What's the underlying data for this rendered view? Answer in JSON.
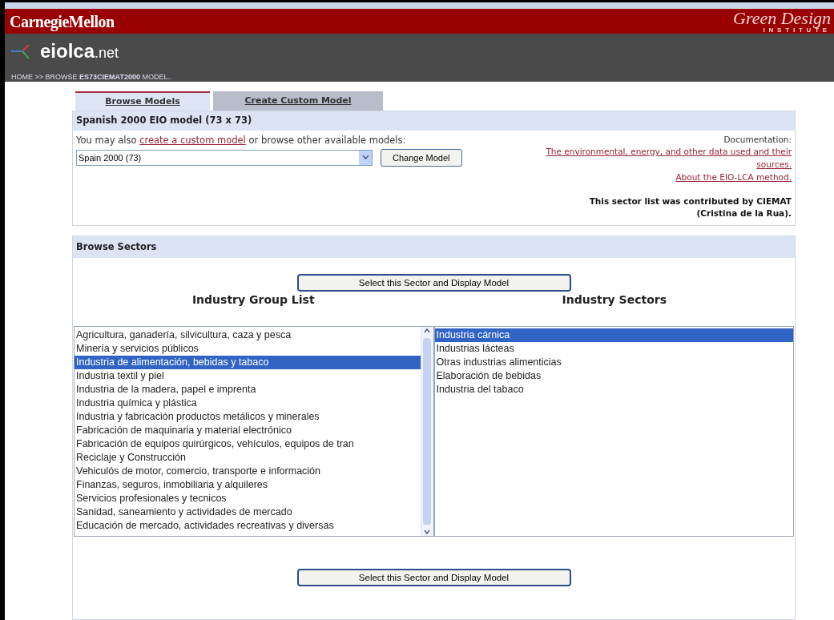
{
  "header": {
    "university": "CarnegieMellon",
    "institute_script": "Green Design",
    "institute_caps": "INSTITUTE",
    "site": "eiolca",
    "site_suffix": ".net",
    "breadcrumb": "HOME >> BROWSE **ES73CIEMAT2000** MODEL.."
  },
  "tabs": [
    {
      "label": "Browse Models",
      "selected": true
    },
    {
      "label": "Create Custom Model",
      "selected": false
    }
  ],
  "model_panel": {
    "title": "Spanish 2000 EIO model (73 x 73)",
    "intro_before": "You may also",
    "intro_link": "create a custom model",
    "intro_after": "or browse other available models:",
    "model_select": "Spain 2000 (73)",
    "change_button": "Change Model",
    "doc_label": "Documentation:",
    "doc_links": [
      "The environmental, energy, and other data used and their sources.",
      "About the EIO-LCA method."
    ],
    "credit": "This sector list was contributed by CIEMAT (Cristina de la Rua)."
  },
  "sectors_panel": {
    "title": "Browse Sectors",
    "select_button_top": "Select this Sector and Display Model",
    "group_heading": "Industry Group List",
    "sector_heading": "Industry Sectors",
    "select_button_bottom": "Select this Sector and Display Model",
    "groups": [
      {
        "label": "Agricultura, ganadería, silvicultura, caza y pesca",
        "selected": false
      },
      {
        "label": "Minería y servicios públicos",
        "selected": false
      },
      {
        "label": "Industria de alimentación, bebidas y tabaco",
        "selected": true
      },
      {
        "label": "Industria textil y piel",
        "selected": false
      },
      {
        "label": "Industria de la madera, papel e imprenta",
        "selected": false
      },
      {
        "label": "Industria química y plástica",
        "selected": false
      },
      {
        "label": "Industria y fabricación productos metálicos y minerales",
        "selected": false
      },
      {
        "label": "Fabricación de maquinaria y material electrónico",
        "selected": false
      },
      {
        "label": "Fabricación de equipos quirúrgicos, vehículos, equipos de tran",
        "selected": false
      },
      {
        "label": "Reciclaje y Construcción",
        "selected": false
      },
      {
        "label": "Vehiculós de motor, comercio, transporte e información",
        "selected": false
      },
      {
        "label": "Finanzas, seguros, inmobiliaria y alquileres",
        "selected": false
      },
      {
        "label": "Servicios profesionales y tecnicos",
        "selected": false
      },
      {
        "label": "Sanidad, saneamiento y actividades de mercado",
        "selected": false
      },
      {
        "label": "Educación de mercado, actividades recreativas y diversas",
        "selected": false
      }
    ],
    "sectors": [
      {
        "label": "Industria cárnica",
        "selected": true
      },
      {
        "label": "Industrias lácteas",
        "selected": false
      },
      {
        "label": "Otras industrias alimenticias",
        "selected": false
      },
      {
        "label": "Elaboración de bebidas",
        "selected": false
      },
      {
        "label": "Industria del tabaco",
        "selected": false
      }
    ]
  }
}
